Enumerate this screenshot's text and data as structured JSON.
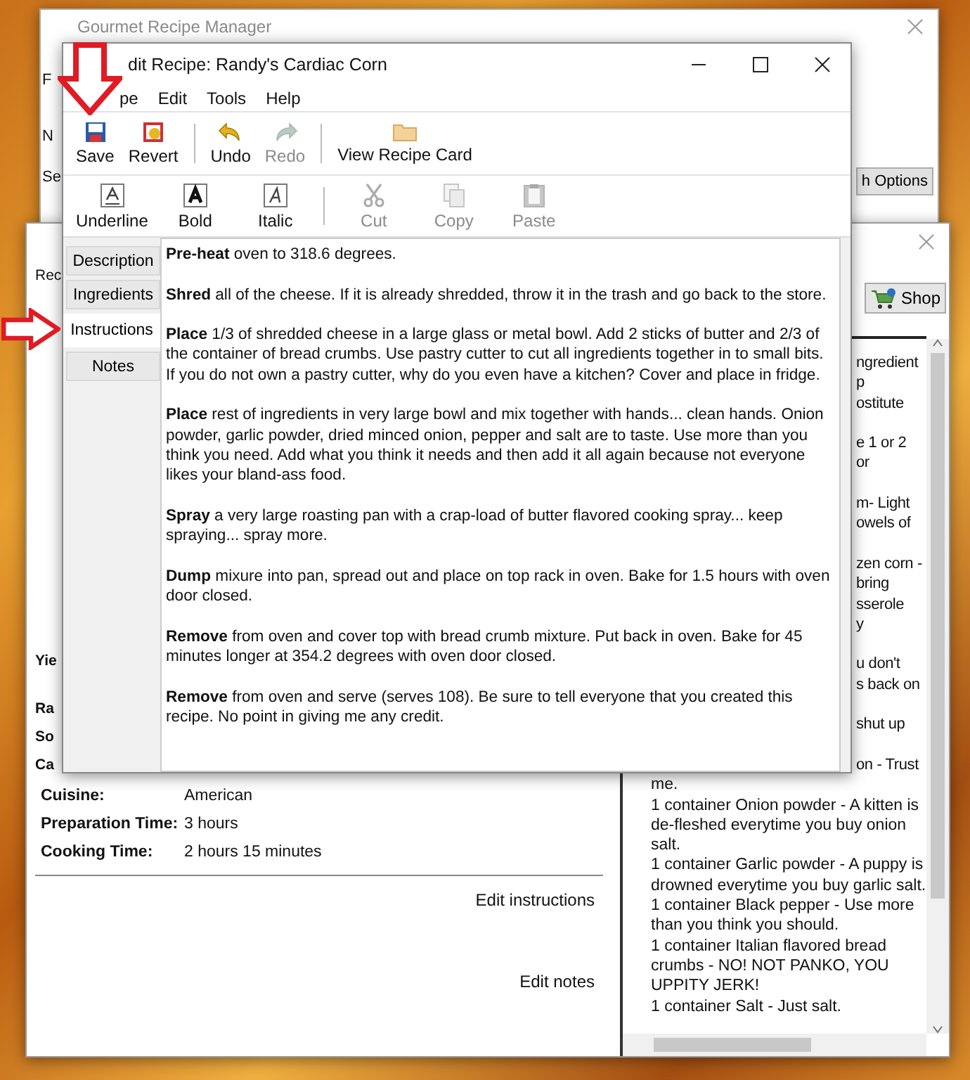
{
  "main_window": {
    "title": "Gourmet Recipe Manager",
    "left_fragments": [
      "F",
      "N",
      "Se"
    ],
    "options_button": "h Options"
  },
  "recipe_window": {
    "tab": "Rec",
    "shop_button": "Shop",
    "field_fragments": [
      "Yie",
      "Ra",
      "So",
      "Ca"
    ],
    "fields": [
      {
        "label": "Cuisine:",
        "value": "American"
      },
      {
        "label": "Preparation Time:",
        "value": "3 hours"
      },
      {
        "label": "Cooking Time:",
        "value": "2 hours 15 minutes"
      }
    ],
    "links": [
      "Edit instructions",
      "Edit notes"
    ],
    "ingredients": {
      "covered_fragments": [
        [
          "ngredient",
          "p",
          "ostitute"
        ],
        [
          "e 1 or 2",
          "or"
        ],
        [
          "m- Light",
          "owels of"
        ],
        [
          "zen corn -",
          "bring",
          "sserole",
          "y"
        ],
        [
          "u don't",
          "s back on"
        ],
        [
          "shut up"
        ],
        [
          "on - Trust"
        ]
      ],
      "lines": [
        "me.",
        "1 container Onion powder - A kitten is de-fleshed everytime you buy onion salt.",
        "1 container Garlic powder - A puppy is drowned everytime you buy garlic salt.",
        "1 container Black pepper - Use more than you think you should.",
        "1 container Italian flavored bread crumbs - NO! NOT PANKO, YOU UPPITY JERK!",
        "1 container Salt - Just salt."
      ]
    }
  },
  "editor": {
    "title": "dit Recipe: Randy's Cardiac Corn",
    "menu": [
      "pe",
      "Edit",
      "Tools",
      "Help"
    ],
    "toolbar": [
      [
        {
          "label": "Save",
          "disabled": false
        },
        {
          "label": "Revert",
          "disabled": false
        }
      ],
      [
        {
          "label": "Undo",
          "disabled": false
        },
        {
          "label": "Redo",
          "disabled": true
        }
      ],
      [
        {
          "label": "View Recipe Card",
          "disabled": false
        }
      ]
    ],
    "format_toolbar": [
      [
        {
          "label": "Underline",
          "disabled": false
        },
        {
          "label": "Bold",
          "disabled": false
        },
        {
          "label": "Italic",
          "disabled": false
        }
      ],
      [
        {
          "label": "Cut",
          "disabled": true
        },
        {
          "label": "Copy",
          "disabled": true
        },
        {
          "label": "Paste",
          "disabled": true
        }
      ]
    ],
    "tabs": [
      {
        "label": "Description",
        "selected": false
      },
      {
        "label": "Ingredients",
        "selected": false
      },
      {
        "label": "Instructions",
        "selected": true
      },
      {
        "label": "Notes",
        "selected": false
      }
    ],
    "instructions": [
      "**Pre-heat** oven to 318.6 degrees.",
      "**Shred** all of the cheese. If it is already shredded, throw it in the trash and go back to the store.",
      "**Place** 1/3 of shredded cheese in a large glass or metal bowl. Add 2 sticks of butter and 2/3 of the container of bread crumbs. Use pastry cutter to cut all ingredients together in to small bits. If you do not own a pastry cutter, why do you even have a kitchen? Cover and place in fridge.",
      "**Place** rest of ingredients in very large bowl and mix together with hands... clean hands. Onion powder, garlic powder, dried minced onion, pepper and salt are to taste. Use more than you think you need. Add what you think it needs and then add it all again because not everyone likes your bland-ass food.",
      "**Spray** a very large roasting pan with a crap-load of butter flavored cooking spray... keep spraying... spray more.",
      "**Dump** mixure into pan, spread out and place on top rack in oven. Bake for 1.5 hours with oven door closed.",
      "**Remove** from oven and cover top with bread crumb mixture. Put back in oven. Bake for 45 minutes longer at 354.2 degrees with oven door closed.",
      "**Remove** from oven and serve (serves 108). Be sure to tell everyone that you created this recipe. No point in giving me any credit."
    ]
  }
}
